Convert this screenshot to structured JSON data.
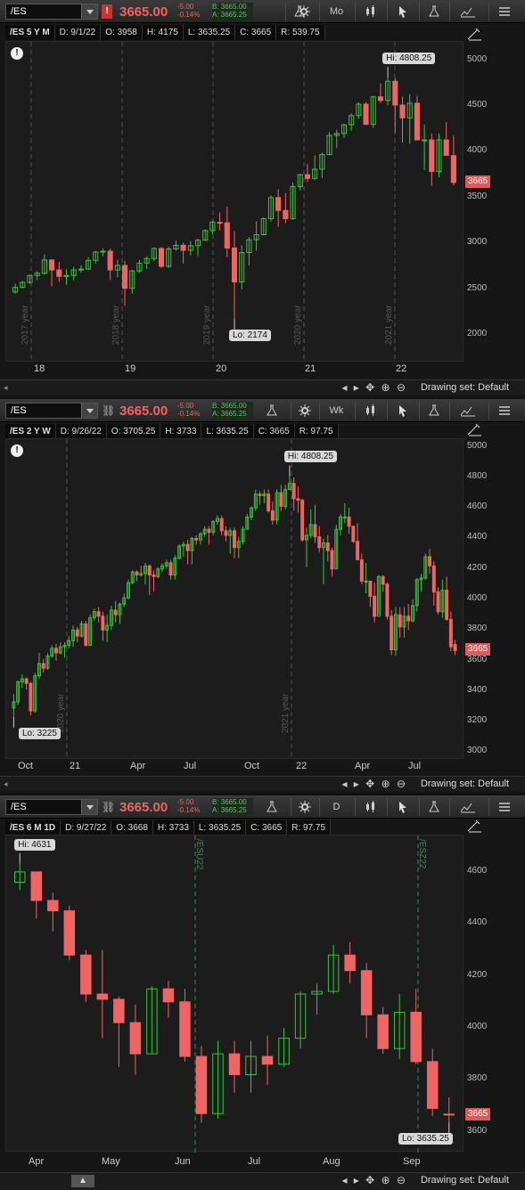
{
  "colors": {
    "up": "#3cc23c",
    "down": "#f06464",
    "bg": "#1c1c1c"
  },
  "quote": {
    "last": "3665.00",
    "change": "-5.00",
    "change_pct": "-0.14%",
    "bid": "B: 3665.00",
    "ask": "A: 3665.25"
  },
  "footer": {
    "drawing_set": "Drawing set: Default"
  },
  "panels": [
    {
      "symbol": "/ES",
      "aggregation": "Mo",
      "info": [
        "/ES 5 Y M",
        "D: 9/1/22",
        "O: 3958",
        "H: 4175",
        "L: 3635.25",
        "C: 3665",
        "R: 539.75"
      ],
      "price_scale": [
        "5000",
        "4500",
        "4000",
        "3500",
        "3000",
        "2500",
        "2000"
      ],
      "x_labels": [
        "18",
        "19",
        "20",
        "21",
        "22"
      ],
      "year_labels": [
        "2017 year",
        "2018 year",
        "2019 year",
        "2020 year",
        "2021 year"
      ],
      "hi": "Hi: 4808.25",
      "lo": "Lo: 2174",
      "last_tag": "3665"
    },
    {
      "symbol": "/ES",
      "aggregation": "Wk",
      "info": [
        "/ES 2 Y W",
        "D: 9/26/22",
        "O: 3705.25",
        "H: 3733",
        "L: 3635.25",
        "C: 3665",
        "R: 97.75"
      ],
      "price_scale": [
        "5000",
        "4800",
        "4600",
        "4400",
        "4200",
        "4000",
        "3800",
        "3600",
        "3400",
        "3200",
        "3000"
      ],
      "x_labels": [
        "Oct",
        "21",
        "Apr",
        "Jul",
        "Oct",
        "22",
        "Apr",
        "Jul"
      ],
      "year_labels": [
        "2020 year",
        "2021 year"
      ],
      "hi": "Hi: 4808.25",
      "lo": "Lo: 3225",
      "last_tag": "3665"
    },
    {
      "symbol": "/ES",
      "aggregation": "D",
      "info": [
        "/ES 6 M 1D",
        "D: 9/27/22",
        "O: 3668",
        "H: 3733",
        "L: 3635.25",
        "C: 3665",
        "R: 97.75"
      ],
      "price_scale": [
        "4600",
        "4400",
        "4200",
        "4000",
        "3800",
        "3600"
      ],
      "x_labels": [
        "Apr",
        "May",
        "Jun",
        "Jul",
        "Aug",
        "Sep"
      ],
      "year_labels": [
        "/ESU22",
        "/ESZ22"
      ],
      "hi": "Hi: 4631",
      "lo": "Lo: 3635.25",
      "last_tag": "3665"
    }
  ],
  "chart_data": [
    {
      "type": "candlestick",
      "title": "/ES 5 Y M",
      "ylim": [
        1700,
        5200
      ],
      "x": [
        "2017-09",
        "2017-10",
        "2017-11",
        "2017-12",
        "2018-01",
        "2018-02",
        "2018-03",
        "2018-04",
        "2018-05",
        "2018-06",
        "2018-07",
        "2018-08",
        "2018-09",
        "2018-10",
        "2018-11",
        "2018-12",
        "2019-01",
        "2019-02",
        "2019-03",
        "2019-04",
        "2019-05",
        "2019-06",
        "2019-07",
        "2019-08",
        "2019-09",
        "2019-10",
        "2019-11",
        "2019-12",
        "2020-01",
        "2020-02",
        "2020-03",
        "2020-04",
        "2020-05",
        "2020-06",
        "2020-07",
        "2020-08",
        "2020-09",
        "2020-10",
        "2020-11",
        "2020-12",
        "2021-01",
        "2021-02",
        "2021-03",
        "2021-04",
        "2021-05",
        "2021-06",
        "2021-07",
        "2021-08",
        "2021-09",
        "2021-10",
        "2021-11",
        "2021-12",
        "2022-01",
        "2022-02",
        "2022-03",
        "2022-04",
        "2022-05",
        "2022-06",
        "2022-07",
        "2022-08",
        "2022-09"
      ],
      "close": [
        2520,
        2575,
        2650,
        2675,
        2820,
        2710,
        2640,
        2650,
        2710,
        2720,
        2815,
        2905,
        2915,
        2710,
        2760,
        2510,
        2700,
        2785,
        2835,
        2945,
        2750,
        2940,
        2980,
        2925,
        2975,
        3035,
        3140,
        3230,
        3225,
        2950,
        2580,
        2900,
        3040,
        3095,
        3270,
        3500,
        3360,
        3270,
        3620,
        3750,
        3710,
        3810,
        3970,
        4180,
        4200,
        4295,
        4395,
        4520,
        4300,
        4600,
        4560,
        4770,
        4510,
        4370,
        4530,
        4130,
        4130,
        3785,
        4130,
        3960,
        3665
      ],
      "high": [
        2560,
        2590,
        2660,
        2695,
        2880,
        2790,
        2800,
        2720,
        2745,
        2760,
        2850,
        2920,
        2945,
        2940,
        2820,
        2810,
        2710,
        2820,
        2860,
        2955,
        2960,
        2965,
        3030,
        3010,
        3025,
        3050,
        3155,
        3250,
        3340,
        3400,
        3135,
        2980,
        3070,
        3240,
        3285,
        3525,
        3590,
        3550,
        3665,
        3760,
        3870,
        3960,
        3990,
        4215,
        4240,
        4305,
        4420,
        4540,
        4545,
        4610,
        4745,
        4810,
        4805,
        4600,
        4630,
        4610,
        4300,
        4200,
        4200,
        4325,
        4175
      ],
      "low": [
        2450,
        2510,
        2560,
        2600,
        2660,
        2530,
        2580,
        2550,
        2600,
        2680,
        2710,
        2780,
        2860,
        2600,
        2630,
        2320,
        2450,
        2680,
        2720,
        2810,
        2730,
        2730,
        2920,
        2780,
        2870,
        2860,
        3030,
        3100,
        3140,
        2850,
        2174,
        2500,
        2760,
        2920,
        3085,
        3240,
        3180,
        3220,
        3260,
        3580,
        3670,
        3690,
        3715,
        3960,
        4040,
        4150,
        4230,
        4360,
        4290,
        4260,
        4530,
        4510,
        4210,
        4100,
        4090,
        4130,
        3800,
        3630,
        3720,
        3960,
        3635
      ],
      "open": [
        2470,
        2520,
        2575,
        2650,
        2675,
        2820,
        2710,
        2640,
        2650,
        2710,
        2720,
        2815,
        2905,
        2915,
        2710,
        2760,
        2510,
        2700,
        2785,
        2835,
        2945,
        2750,
        2940,
        2980,
        2925,
        2975,
        3035,
        3140,
        3230,
        3225,
        2950,
        2580,
        2900,
        3040,
        3095,
        3270,
        3500,
        3360,
        3270,
        3620,
        3750,
        3710,
        3810,
        3970,
        4180,
        4200,
        4295,
        4395,
        4520,
        4300,
        4600,
        4560,
        4770,
        4510,
        4370,
        4530,
        4130,
        4130,
        3785,
        4130,
        3958
      ]
    },
    {
      "type": "candlestick",
      "title": "/ES 2 Y W",
      "ylim": [
        2950,
        5050
      ],
      "x": [
        "2020-09-28",
        "2020-10-05",
        "2020-10-12",
        "2020-10-19",
        "2020-10-26",
        "2020-11-02",
        "2020-11-09",
        "2020-11-16",
        "2020-11-23",
        "2020-11-30",
        "2020-12-07",
        "2020-12-14",
        "2020-12-21",
        "2020-12-28",
        "2021-01-04",
        "2021-01-11",
        "2021-01-18",
        "2021-01-25",
        "2021-02-01",
        "2021-02-08",
        "2021-02-15",
        "2021-02-22",
        "2021-03-01",
        "2021-03-08",
        "2021-03-15",
        "2021-03-22",
        "2021-03-29",
        "2021-04-05",
        "2021-04-12",
        "2021-04-19",
        "2021-04-26",
        "2021-05-03",
        "2021-05-10",
        "2021-05-17",
        "2021-05-24",
        "2021-05-31",
        "2021-06-07",
        "2021-06-14",
        "2021-06-21",
        "2021-06-28",
        "2021-07-05",
        "2021-07-12",
        "2021-07-19",
        "2021-07-26",
        "2021-08-02",
        "2021-08-09",
        "2021-08-16",
        "2021-08-23",
        "2021-08-30",
        "2021-09-06",
        "2021-09-13",
        "2021-09-20",
        "2021-09-27",
        "2021-10-04",
        "2021-10-11",
        "2021-10-18",
        "2021-10-25",
        "2021-11-01",
        "2021-11-08",
        "2021-11-15",
        "2021-11-22",
        "2021-11-29",
        "2021-12-06",
        "2021-12-13",
        "2021-12-20",
        "2021-12-27",
        "2022-01-03",
        "2022-01-10",
        "2022-01-17",
        "2022-01-24",
        "2022-01-31",
        "2022-02-07",
        "2022-02-14",
        "2022-02-21",
        "2022-02-28",
        "2022-03-07",
        "2022-03-14",
        "2022-03-21",
        "2022-03-28",
        "2022-04-04",
        "2022-04-11",
        "2022-04-18",
        "2022-04-25",
        "2022-05-02",
        "2022-05-09",
        "2022-05-16",
        "2022-05-23",
        "2022-05-30",
        "2022-06-06",
        "2022-06-13",
        "2022-06-20",
        "2022-06-27",
        "2022-07-04",
        "2022-07-11",
        "2022-07-18",
        "2022-07-25",
        "2022-08-01",
        "2022-08-08",
        "2022-08-15",
        "2022-08-22",
        "2022-08-29",
        "2022-09-05",
        "2022-09-12",
        "2022-09-19",
        "2022-09-26"
      ],
      "close": [
        3330,
        3460,
        3480,
        3450,
        3270,
        3500,
        3580,
        3550,
        3630,
        3680,
        3650,
        3690,
        3700,
        3730,
        3800,
        3760,
        3840,
        3700,
        3880,
        3920,
        3890,
        3800,
        3830,
        3930,
        3900,
        3970,
        4010,
        4110,
        4180,
        4160,
        4170,
        4220,
        4160,
        4150,
        4200,
        4220,
        4240,
        4160,
        4270,
        4350,
        4360,
        4320,
        4400,
        4390,
        4430,
        4460,
        4440,
        4510,
        4530,
        4450,
        4420,
        4450,
        4340,
        4380,
        4460,
        4540,
        4600,
        4690,
        4680,
        4690,
        4580,
        4520,
        4700,
        4610,
        4720,
        4760,
        4660,
        4650,
        4390,
        4420,
        4490,
        4410,
        4340,
        4370,
        4320,
        4200,
        4460,
        4540,
        4540,
        4480,
        4380,
        4260,
        4120,
        4120,
        4020,
        3890,
        4150,
        4100,
        3890,
        3670,
        3900,
        3820,
        3890,
        3860,
        3960,
        4130,
        4140,
        4280,
        4220,
        4050,
        3920,
        4060,
        3870,
        3690,
        3665
      ],
      "high": [
        3380,
        3470,
        3510,
        3490,
        3460,
        3520,
        3650,
        3610,
        3650,
        3700,
        3710,
        3720,
        3720,
        3760,
        3830,
        3820,
        3860,
        3860,
        3900,
        3940,
        3950,
        3920,
        3900,
        3960,
        3990,
        3980,
        4040,
        4130,
        4190,
        4190,
        4220,
        4240,
        4230,
        4190,
        4210,
        4240,
        4260,
        4260,
        4290,
        4360,
        4380,
        4390,
        4410,
        4420,
        4440,
        4480,
        4480,
        4520,
        4550,
        4550,
        4480,
        4470,
        4470,
        4410,
        4480,
        4560,
        4610,
        4720,
        4710,
        4720,
        4720,
        4640,
        4720,
        4750,
        4750,
        4808,
        4800,
        4740,
        4660,
        4470,
        4590,
        4620,
        4480,
        4400,
        4420,
        4340,
        4490,
        4560,
        4630,
        4600,
        4480,
        4500,
        4300,
        4240,
        4120,
        4110,
        4160,
        4160,
        4110,
        3930,
        3950,
        3950,
        3950,
        3970,
        4000,
        4140,
        4170,
        4300,
        4330,
        4250,
        4080,
        4130,
        4150,
        3920,
        3733
      ],
      "low": [
        3230,
        3310,
        3420,
        3410,
        3240,
        3260,
        3480,
        3520,
        3540,
        3620,
        3600,
        3640,
        3620,
        3680,
        3690,
        3720,
        3750,
        3690,
        3700,
        3860,
        3850,
        3730,
        3720,
        3800,
        3850,
        3840,
        3950,
        4000,
        4100,
        4120,
        4150,
        4100,
        4030,
        4050,
        4140,
        4180,
        4200,
        4130,
        4130,
        4260,
        4280,
        4230,
        4230,
        4360,
        4360,
        4410,
        4360,
        4420,
        4490,
        4420,
        4380,
        4300,
        4270,
        4270,
        4360,
        4460,
        4520,
        4580,
        4620,
        4630,
        4570,
        4490,
        4490,
        4580,
        4590,
        4720,
        4580,
        4570,
        4380,
        4210,
        4400,
        4370,
        4310,
        4100,
        4250,
        4150,
        4200,
        4420,
        4500,
        4430,
        4370,
        4260,
        4100,
        4040,
        3950,
        3850,
        3900,
        4050,
        3870,
        3635,
        3630,
        3750,
        3750,
        3800,
        3850,
        3920,
        4050,
        4130,
        4170,
        3960,
        3900,
        3880,
        3860,
        3660,
        3635
      ],
      "open": [
        3290,
        3330,
        3460,
        3480,
        3450,
        3270,
        3500,
        3580,
        3550,
        3630,
        3680,
        3650,
        3690,
        3700,
        3730,
        3800,
        3760,
        3840,
        3700,
        3880,
        3920,
        3890,
        3800,
        3830,
        3930,
        3900,
        3970,
        4010,
        4110,
        4180,
        4160,
        4170,
        4220,
        4160,
        4150,
        4200,
        4220,
        4240,
        4160,
        4270,
        4350,
        4360,
        4320,
        4400,
        4390,
        4430,
        4460,
        4440,
        4510,
        4530,
        4450,
        4420,
        4450,
        4340,
        4380,
        4460,
        4540,
        4600,
        4690,
        4680,
        4690,
        4580,
        4520,
        4700,
        4610,
        4720,
        4760,
        4660,
        4650,
        4390,
        4420,
        4490,
        4410,
        4340,
        4370,
        4320,
        4200,
        4460,
        4540,
        4540,
        4480,
        4380,
        4260,
        4120,
        4120,
        4020,
        3890,
        4150,
        4100,
        3890,
        3670,
        3900,
        3820,
        3890,
        3860,
        3960,
        4130,
        4140,
        4280,
        4220,
        4050,
        3920,
        4060,
        3870,
        3705
      ]
    },
    {
      "type": "candlestick",
      "title": "/ES 6 M 1D",
      "ylim": [
        3520,
        4740
      ],
      "x": [
        "2022-03-28",
        "2022-04-04",
        "2022-04-11",
        "2022-04-18",
        "2022-04-25",
        "2022-05-02",
        "2022-05-09",
        "2022-05-16",
        "2022-05-23",
        "2022-05-30",
        "2022-06-06",
        "2022-06-13",
        "2022-06-20",
        "2022-06-27",
        "2022-07-04",
        "2022-07-11",
        "2022-07-18",
        "2022-07-25",
        "2022-08-01",
        "2022-08-08",
        "2022-08-15",
        "2022-08-22",
        "2022-08-29",
        "2022-09-05",
        "2022-09-12",
        "2022-09-19",
        "2022-09-26"
      ],
      "close": [
        4600,
        4490,
        4450,
        4280,
        4130,
        4110,
        4020,
        3900,
        4150,
        4100,
        3890,
        3670,
        3900,
        3820,
        3890,
        3860,
        3960,
        4130,
        4140,
        4280,
        4220,
        4050,
        3920,
        4060,
        3870,
        3690,
        3665
      ],
      "high": [
        4631,
        4600,
        4520,
        4470,
        4300,
        4300,
        4120,
        4090,
        4160,
        4180,
        4150,
        3930,
        3950,
        3950,
        3950,
        3970,
        4000,
        4140,
        4170,
        4320,
        4330,
        4250,
        4080,
        4130,
        4150,
        3920,
        3733
      ],
      "low": [
        4530,
        4420,
        4370,
        4260,
        4100,
        3960,
        3850,
        3820,
        3900,
        4040,
        3870,
        3635,
        3650,
        3750,
        3750,
        3780,
        3850,
        3920,
        4050,
        4130,
        4170,
        3960,
        3900,
        3880,
        3860,
        3660,
        3635
      ],
      "open": [
        4560,
        4600,
        4490,
        4450,
        4280,
        4130,
        4110,
        4020,
        3900,
        4150,
        4100,
        3890,
        3670,
        3900,
        3820,
        3890,
        3860,
        3960,
        4130,
        4140,
        4280,
        4220,
        4050,
        3920,
        4060,
        3870,
        3668
      ]
    }
  ]
}
